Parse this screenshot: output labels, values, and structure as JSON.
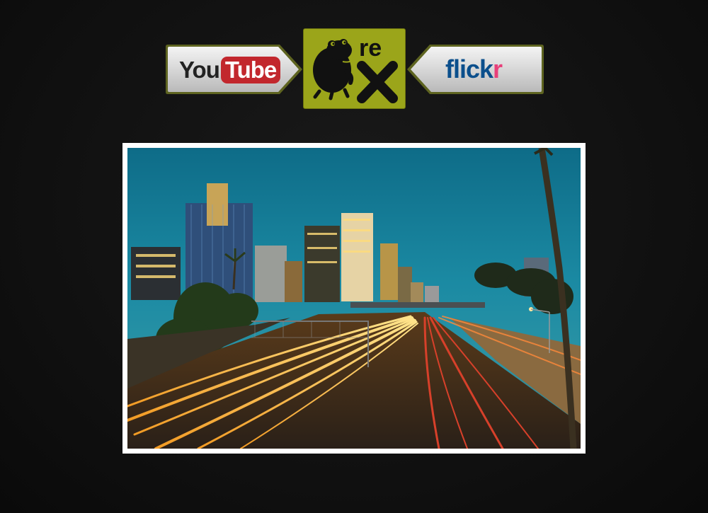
{
  "header": {
    "youtube": {
      "you": "You",
      "tube": "Tube"
    },
    "rex": {
      "text_top": "re",
      "text_bottom": "x"
    },
    "flickr": {
      "flick": "flick",
      "r": "r"
    }
  },
  "colors": {
    "background": "#111111",
    "rex_green": "#9ba51a",
    "youtube_red": "#c2272d",
    "flickr_blue": "#0b4f8c",
    "flickr_pink": "#e8407a",
    "frame": "#ffffff"
  },
  "photo": {
    "subject": "night-city-highway"
  }
}
